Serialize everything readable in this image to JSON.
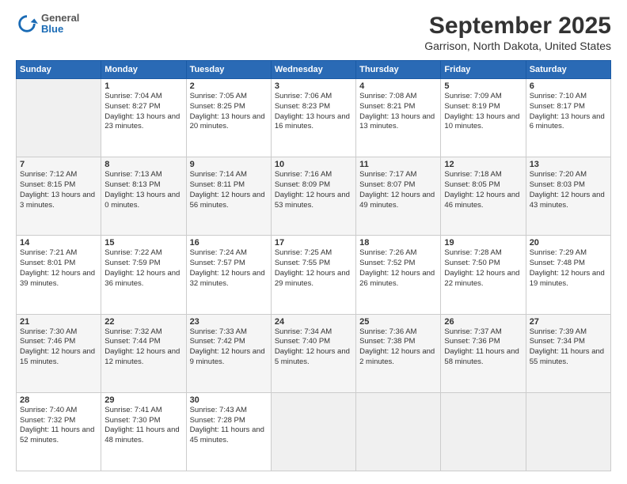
{
  "header": {
    "logo": {
      "general": "General",
      "blue": "Blue"
    },
    "title": "September 2025",
    "location": "Garrison, North Dakota, United States"
  },
  "weekdays": [
    "Sunday",
    "Monday",
    "Tuesday",
    "Wednesday",
    "Thursday",
    "Friday",
    "Saturday"
  ],
  "weeks": [
    [
      {
        "day": null,
        "info": null
      },
      {
        "day": "1",
        "sunrise": "7:04 AM",
        "sunset": "8:27 PM",
        "daylight": "13 hours and 23 minutes."
      },
      {
        "day": "2",
        "sunrise": "7:05 AM",
        "sunset": "8:25 PM",
        "daylight": "13 hours and 20 minutes."
      },
      {
        "day": "3",
        "sunrise": "7:06 AM",
        "sunset": "8:23 PM",
        "daylight": "13 hours and 16 minutes."
      },
      {
        "day": "4",
        "sunrise": "7:08 AM",
        "sunset": "8:21 PM",
        "daylight": "13 hours and 13 minutes."
      },
      {
        "day": "5",
        "sunrise": "7:09 AM",
        "sunset": "8:19 PM",
        "daylight": "13 hours and 10 minutes."
      },
      {
        "day": "6",
        "sunrise": "7:10 AM",
        "sunset": "8:17 PM",
        "daylight": "13 hours and 6 minutes."
      }
    ],
    [
      {
        "day": "7",
        "sunrise": "7:12 AM",
        "sunset": "8:15 PM",
        "daylight": "13 hours and 3 minutes."
      },
      {
        "day": "8",
        "sunrise": "7:13 AM",
        "sunset": "8:13 PM",
        "daylight": "13 hours and 0 minutes."
      },
      {
        "day": "9",
        "sunrise": "7:14 AM",
        "sunset": "8:11 PM",
        "daylight": "12 hours and 56 minutes."
      },
      {
        "day": "10",
        "sunrise": "7:16 AM",
        "sunset": "8:09 PM",
        "daylight": "12 hours and 53 minutes."
      },
      {
        "day": "11",
        "sunrise": "7:17 AM",
        "sunset": "8:07 PM",
        "daylight": "12 hours and 49 minutes."
      },
      {
        "day": "12",
        "sunrise": "7:18 AM",
        "sunset": "8:05 PM",
        "daylight": "12 hours and 46 minutes."
      },
      {
        "day": "13",
        "sunrise": "7:20 AM",
        "sunset": "8:03 PM",
        "daylight": "12 hours and 43 minutes."
      }
    ],
    [
      {
        "day": "14",
        "sunrise": "7:21 AM",
        "sunset": "8:01 PM",
        "daylight": "12 hours and 39 minutes."
      },
      {
        "day": "15",
        "sunrise": "7:22 AM",
        "sunset": "7:59 PM",
        "daylight": "12 hours and 36 minutes."
      },
      {
        "day": "16",
        "sunrise": "7:24 AM",
        "sunset": "7:57 PM",
        "daylight": "12 hours and 32 minutes."
      },
      {
        "day": "17",
        "sunrise": "7:25 AM",
        "sunset": "7:55 PM",
        "daylight": "12 hours and 29 minutes."
      },
      {
        "day": "18",
        "sunrise": "7:26 AM",
        "sunset": "7:52 PM",
        "daylight": "12 hours and 26 minutes."
      },
      {
        "day": "19",
        "sunrise": "7:28 AM",
        "sunset": "7:50 PM",
        "daylight": "12 hours and 22 minutes."
      },
      {
        "day": "20",
        "sunrise": "7:29 AM",
        "sunset": "7:48 PM",
        "daylight": "12 hours and 19 minutes."
      }
    ],
    [
      {
        "day": "21",
        "sunrise": "7:30 AM",
        "sunset": "7:46 PM",
        "daylight": "12 hours and 15 minutes."
      },
      {
        "day": "22",
        "sunrise": "7:32 AM",
        "sunset": "7:44 PM",
        "daylight": "12 hours and 12 minutes."
      },
      {
        "day": "23",
        "sunrise": "7:33 AM",
        "sunset": "7:42 PM",
        "daylight": "12 hours and 9 minutes."
      },
      {
        "day": "24",
        "sunrise": "7:34 AM",
        "sunset": "7:40 PM",
        "daylight": "12 hours and 5 minutes."
      },
      {
        "day": "25",
        "sunrise": "7:36 AM",
        "sunset": "7:38 PM",
        "daylight": "12 hours and 2 minutes."
      },
      {
        "day": "26",
        "sunrise": "7:37 AM",
        "sunset": "7:36 PM",
        "daylight": "11 hours and 58 minutes."
      },
      {
        "day": "27",
        "sunrise": "7:39 AM",
        "sunset": "7:34 PM",
        "daylight": "11 hours and 55 minutes."
      }
    ],
    [
      {
        "day": "28",
        "sunrise": "7:40 AM",
        "sunset": "7:32 PM",
        "daylight": "11 hours and 52 minutes."
      },
      {
        "day": "29",
        "sunrise": "7:41 AM",
        "sunset": "7:30 PM",
        "daylight": "11 hours and 48 minutes."
      },
      {
        "day": "30",
        "sunrise": "7:43 AM",
        "sunset": "7:28 PM",
        "daylight": "11 hours and 45 minutes."
      },
      {
        "day": null,
        "info": null
      },
      {
        "day": null,
        "info": null
      },
      {
        "day": null,
        "info": null
      },
      {
        "day": null,
        "info": null
      }
    ]
  ]
}
